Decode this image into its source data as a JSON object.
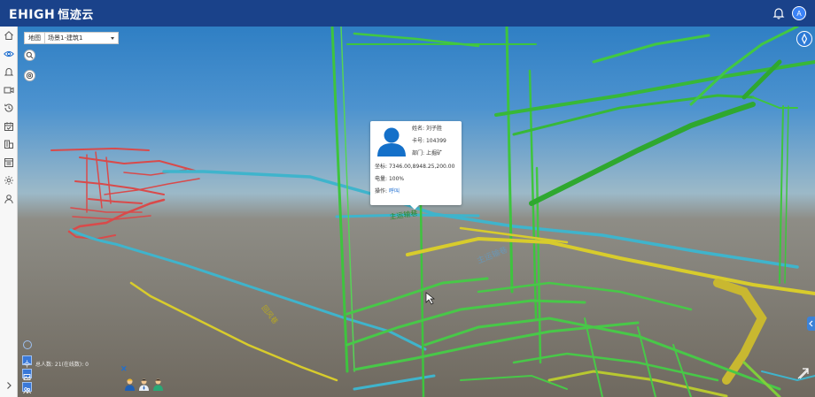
{
  "app": {
    "brand_latin": "EHIGH",
    "brand_chinese": "恒迹云",
    "user_initial": "A"
  },
  "colors": {
    "header": "#1a428a",
    "accent": "#1f6fd1",
    "tunnel_green": "#3ec43e",
    "tunnel_cyan": "#3fb4cc",
    "tunnel_red": "#d94a4a",
    "tunnel_yellow": "#d8cc2c"
  },
  "sidebar": {
    "items": [
      {
        "icon": "home-icon"
      },
      {
        "icon": "eye-icon",
        "active": true
      },
      {
        "icon": "alarm-icon"
      },
      {
        "icon": "video-icon"
      },
      {
        "icon": "history-icon"
      },
      {
        "icon": "calendar-icon"
      },
      {
        "icon": "building-icon"
      },
      {
        "icon": "report-icon"
      },
      {
        "icon": "settings-icon"
      },
      {
        "icon": "user-icon"
      }
    ],
    "expand_icon": "chevron-right-icon"
  },
  "map_bar": {
    "map_label": "地图",
    "scene_value": "场景1-建筑1"
  },
  "popup": {
    "name_label": "姓名:",
    "name_value": "刘子胜",
    "card_label": "卡号:",
    "card_value": "104399",
    "dept_label": "部门:",
    "dept_value": "上掘矿",
    "coord_label": "坐标:",
    "coord_value": "7346.00,8948.25,200.00",
    "battery_label": "电量:",
    "battery_value": "100%",
    "action_label": "操作:",
    "action_link": "呼叫"
  },
  "scene_labels": {
    "main_tunnel": "主运输巷",
    "left_tunnel": "回风巷",
    "right_tunnel": "主运输巷"
  },
  "status": {
    "people_count_text": "总人数:  21(在线数):  0"
  }
}
